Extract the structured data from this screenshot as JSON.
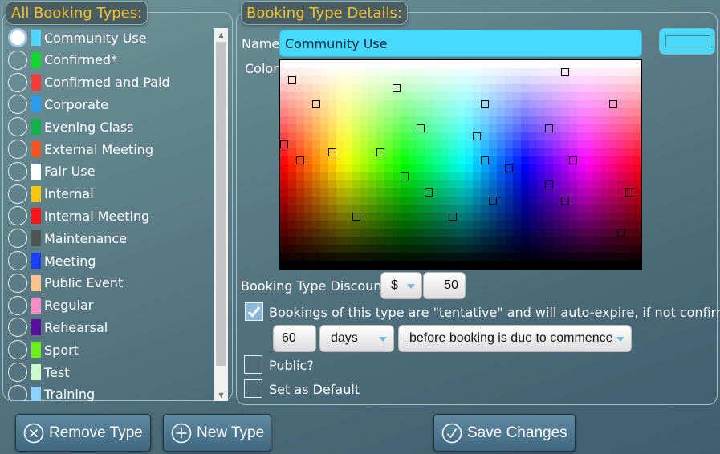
{
  "left_panel": {
    "title": "All Booking Types:",
    "types": [
      {
        "label": "Community Use",
        "color": "#4dd4ff",
        "selected": true
      },
      {
        "label": "Confirmed*",
        "color": "#12d62b",
        "selected": false
      },
      {
        "label": "Confirmed and Paid",
        "color": "#f23b3b",
        "selected": false
      },
      {
        "label": "Corporate",
        "color": "#2b9bef",
        "selected": false
      },
      {
        "label": "Evening Class",
        "color": "#12b04a",
        "selected": false
      },
      {
        "label": "External Meeting",
        "color": "#f25524",
        "selected": false
      },
      {
        "label": "Fair Use",
        "color": "#ffffff",
        "selected": false
      },
      {
        "label": "Internal",
        "color": "#f9c80e",
        "selected": false
      },
      {
        "label": "Internal Meeting",
        "color": "#ff1414",
        "selected": false
      },
      {
        "label": "Maintenance",
        "color": "#505553",
        "selected": false
      },
      {
        "label": "Meeting",
        "color": "#1a3dff",
        "selected": false
      },
      {
        "label": "Public Event",
        "color": "#fdc28e",
        "selected": false
      },
      {
        "label": "Regular",
        "color": "#f98cc4",
        "selected": false
      },
      {
        "label": "Rehearsal",
        "color": "#5a0ea0",
        "selected": false
      },
      {
        "label": "Sport",
        "color": "#6cf21a",
        "selected": false
      },
      {
        "label": "Test",
        "color": "#cdfacb",
        "selected": false
      },
      {
        "label": "Training",
        "color": "#8ad2ff",
        "selected": false
      }
    ],
    "scroll_up_icon": "▲",
    "scroll_down_icon": "▼"
  },
  "details": {
    "title": "Booking Type Details:",
    "name_label": "Name",
    "name_value": "Community Use",
    "color_label": "Color",
    "selected_color": "#47d9ff",
    "discount_label": "Booking Type Discount",
    "discount_unit": "$",
    "discount_value": "50",
    "tentative_checked": true,
    "tentative_label": "Bookings of this type are \"tentative\" and will auto-expire, if not confirmed:",
    "expire_amount": "60",
    "expire_unit": "days",
    "expire_when": "before booking is due to commence",
    "public_label": "Public?",
    "public_checked": false,
    "default_label": "Set as Default",
    "default_checked": false
  },
  "actions": {
    "remove_label": "Remove Type",
    "new_label": "New Type",
    "save_label": "Save Changes"
  }
}
